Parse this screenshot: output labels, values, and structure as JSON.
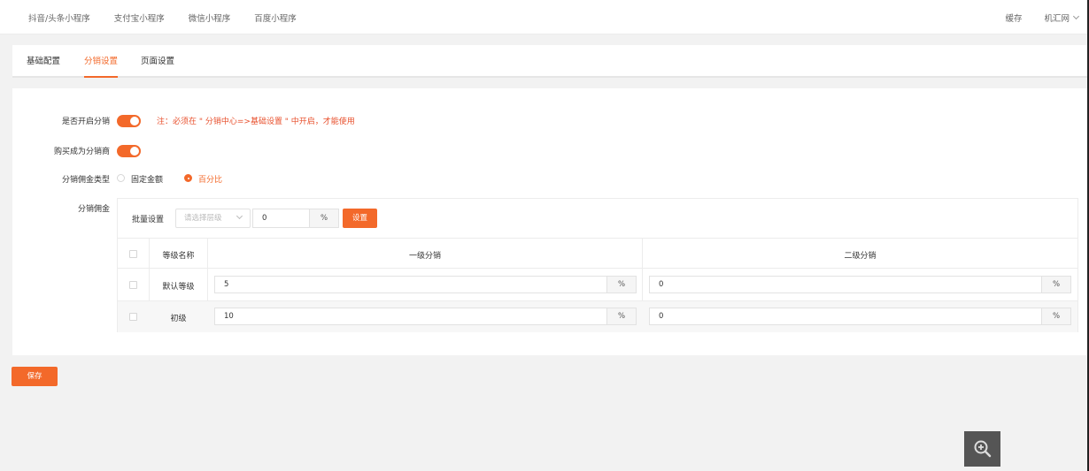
{
  "topnav": [
    "抖音/头条小程序",
    "支付宝小程序",
    "微信小程序",
    "百度小程序"
  ],
  "topright": {
    "cache": "缓存",
    "user": "机汇网"
  },
  "tabs": [
    "基础配置",
    "分销设置",
    "页面设置"
  ],
  "form": {
    "enable_label": "是否开启分销",
    "enable_note": "注：必须在 \" 分销中心=>基础设置 \" 中开启，才能使用",
    "buy_become_label": "购买成为分销商",
    "commission_type_label": "分销佣金类型",
    "type_fixed": "固定金额",
    "type_percent": "百分比",
    "commission_label": "分销佣金"
  },
  "batch": {
    "label": "批量设置",
    "select_placeholder": "请选择层级",
    "value": "0",
    "unit": "%",
    "button": "设置"
  },
  "table": {
    "headers": [
      "等级名称",
      "一级分销",
      "二级分销"
    ],
    "rows": [
      {
        "name": "默认等级",
        "level1": "5",
        "level2": "0",
        "unit1": "%",
        "unit2": "%"
      },
      {
        "name": "初级",
        "level1": "10",
        "level2": "0",
        "unit1": "%",
        "unit2": "%"
      }
    ]
  },
  "save_button": "保存"
}
